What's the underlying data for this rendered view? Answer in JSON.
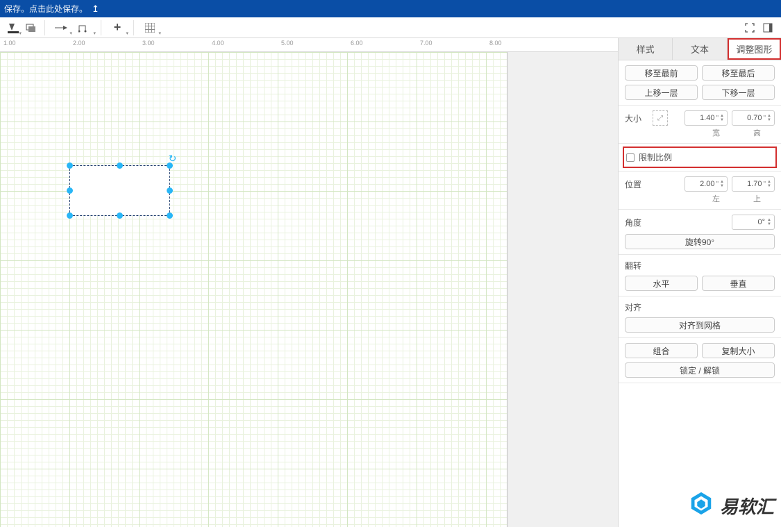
{
  "titlebar": {
    "text": "保存。点击此处保存。",
    "share_icon": "↥"
  },
  "ruler": {
    "ticks": [
      {
        "pos": 5,
        "label": "1.00"
      },
      {
        "pos": 105,
        "label": "2.00"
      },
      {
        "pos": 205,
        "label": "3.00"
      },
      {
        "pos": 305,
        "label": "4.00"
      },
      {
        "pos": 405,
        "label": "5.00"
      },
      {
        "pos": 505,
        "label": "6.00"
      },
      {
        "pos": 605,
        "label": "7.00"
      },
      {
        "pos": 705,
        "label": "8.00"
      }
    ]
  },
  "tabs": {
    "style": "样式",
    "text": "文本",
    "arrange": "调整图形"
  },
  "arrange": {
    "to_front": "移至最前",
    "to_back": "移至最后",
    "forward": "上移一层",
    "backward": "下移一层",
    "size_label": "大小",
    "width_val": "1.40",
    "height_val": "0.70",
    "unit": "\"",
    "width_lbl": "宽",
    "height_lbl": "高",
    "constrain": "限制比例",
    "pos_label": "位置",
    "x_val": "2.00",
    "y_val": "1.70",
    "x_lbl": "左",
    "y_lbl": "上",
    "angle_label": "角度",
    "angle_val": "0°",
    "rotate90": "旋转90°",
    "flip_h": "翻转",
    "flip_hor": "水平",
    "flip_ver": "垂直",
    "align_h": "对齐",
    "snap": "对齐到网格",
    "group": "组合",
    "copysize": "复制大小",
    "lock": "锁定 / 解锁"
  },
  "watermark": "易软汇"
}
